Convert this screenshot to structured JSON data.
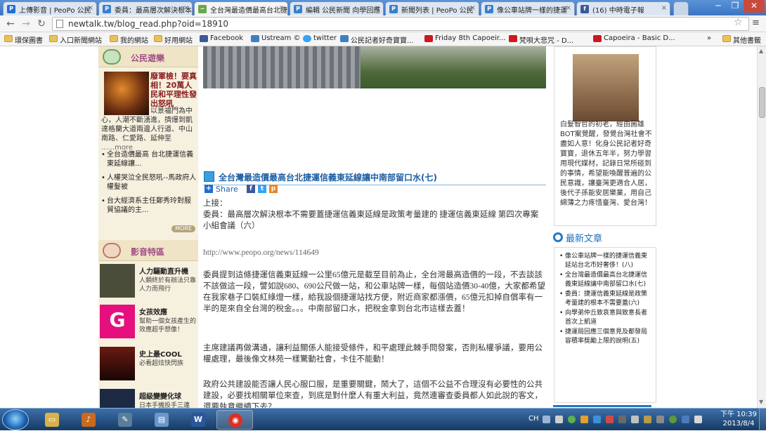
{
  "browser": {
    "tabs": [
      {
        "title": "上傳影音 | PeoPo 公民",
        "favicon_text": "P",
        "favicon_color": "#1f6fd1"
      },
      {
        "title": "委員：最高層次解決根本",
        "favicon_text": "P",
        "favicon_color": "#3a7fd0"
      },
      {
        "title": "全台灣最造價最高台北捷",
        "favicon_text": "~",
        "favicon_color": "#6aa64a"
      },
      {
        "title": "編輯 公民新聞 向學回應",
        "favicon_text": "P",
        "favicon_color": "#3a7fd0"
      },
      {
        "title": "新聞列表 | PeoPo 公民",
        "favicon_text": "P",
        "favicon_color": "#3a7fd0"
      },
      {
        "title": "像公車站牌一樣的捷運",
        "favicon_text": "P",
        "favicon_color": "#3a7fd0"
      },
      {
        "title": "(16) 中時電子報",
        "favicon_text": "f",
        "favicon_color": "#3b5998"
      }
    ],
    "active_tab_index": 2,
    "url": "newtalk.tw/blog_read.php?oid=18910",
    "bookmarks": [
      {
        "label": "環保圖書",
        "icon": "folder-icon"
      },
      {
        "label": "入口新聞網站",
        "icon": "folder-icon"
      },
      {
        "label": "我的網站",
        "icon": "folder-icon"
      },
      {
        "label": "好用網站",
        "icon": "folder-icon"
      },
      {
        "label": "Facebook",
        "icon": "facebook-icon"
      },
      {
        "label": "Ustream ©",
        "icon": "ustream-icon"
      },
      {
        "label": "twitter",
        "icon": "twitter-icon"
      },
      {
        "label": "公民記者好奇寶寶...",
        "icon": "ustream-icon"
      },
      {
        "label": "Friday 8th Capoeir...",
        "icon": "youtube-icon"
      },
      {
        "label": "梵唄大悲咒 - D...",
        "icon": "youtube-icon"
      },
      {
        "label": "Capoeira - Basic D...",
        "icon": "youtube-icon"
      }
    ],
    "bookmarks_overflow": "»",
    "other_bookmarks": "其他書籤"
  },
  "sidebar": {
    "citizen_section_title": "公民遊樂",
    "feature": {
      "title": "廢軍檢！要真相！20萬人民和平理性發出怒吼",
      "body": "以景福門為中心，人潮不斷湧進，擠爆到凱達格蘭大道兩邊人行道、中山南路、仁愛路、延伸至",
      "more": "......more"
    },
    "links": [
      "全台造價最高 台北捷運信義東延線讓...",
      "人權哭泣全民怒吼--馬政府人權髮被",
      "台大經濟系主任鄭秀玲對服貿協議的主..."
    ],
    "more_badge": "MORE",
    "video_section_title": "影音特區",
    "videos": [
      {
        "title": "人力驅動直升機",
        "desc": "人類終於有辦法只靠人力而飛行",
        "thumb_color": "#4a4d3a"
      },
      {
        "title": "女孩效應",
        "desc": "幫助一個女孩產生的效應超乎想像！",
        "thumb_color": "#e5107e",
        "thumb_glyph": "G"
      },
      {
        "title": "史上最COOL",
        "desc": "必看超炫快閃族",
        "thumb_color": "#3a0d0a"
      },
      {
        "title": "超級變變化球",
        "desc": "日本手機投手三連",
        "thumb_color": "#1c2a44"
      }
    ]
  },
  "article": {
    "title": "全台灣最造價最高台北捷運信義東延線讓中南部留口水(七)",
    "share_label": "Share",
    "paragraphs": [
      "上接：",
      "委員：最高層次解決根本不需要蓋捷運信義東延線是政策考量建的 捷運信義東延線 第四次專案小組會議（六）",
      "http://www.peopo.org/news/114649",
      "委員提到這條捷運信義東延線一公里65億元是截至目前為止，全台灣最高造價的一段，不去談該不該做這一段，譬如說680、690公尺做一站，和公車站牌一樣，每個站造價30-40億，大家都希望在我家巷子口裝紅綠燈一樣，給我設個捷運站找方便，附近商家都漲價，65億元扣掉自償率有一半的是來自全台灣的稅金。。。中南部留口水，把稅金拿到台北市這樣去蓋！",
      "主席建議再做溝通，讓利益關係人能接受條件，和平處理此棘手問發案，否則私權爭議，要用公權處理，最後像文林苑一樣驚動社會，卡住不能動！",
      "政府公共建設能否讓人民心服口服，是重要關鍵，鬧大了，這個不公益不合理沒有必要性的公共建設，必要找相關單位來查，到底是對什麼人有重大利益，竟然連審查委員都人如此說的客文，還要執意繼續下去？"
    ]
  },
  "right": {
    "profile_text": "白髮智哲的初老，經由圖雄BOT案覺醒，發覺台灣社會不盡如人意！化身公民記者好奇寶寶，退休五年半，努力學習用現代媒材，記錄日常所碰到的事情，希望能喚醒普遍的公民意識，讓臺灣更適合人居，後代子孫能安居樂業，用自己綿薄之力疼惜臺灣、愛台灣！",
    "latest_title": "最新文章",
    "latest": [
      "像公車站牌一樣的捷運信義東延站台北市好奢侈！(八)",
      "全台灣最造價最高台北捷運信義東延線讓中南部留口水(七)",
      "委員：捷運信義東延線是政策考量建的根本不需要蓋(六)",
      "向學弟仲丘致哀意與致意長者首次上凱道",
      "捷運局回應三個意見及都發局容積率獎勵上限的說明(五)"
    ]
  },
  "taskbar": {
    "apps": [
      {
        "name": "file-explorer",
        "glyph": "▭",
        "color": "#d9b24a"
      },
      {
        "name": "media-player",
        "glyph": "♪",
        "color": "#c96a1f"
      },
      {
        "name": "tools",
        "glyph": "✎",
        "color": "#5a7d9a"
      },
      {
        "name": "notepad",
        "glyph": "▤",
        "color": "#6a96c8"
      },
      {
        "name": "word",
        "glyph": "W",
        "color": "#2b579a"
      },
      {
        "name": "chrome",
        "glyph": "◉",
        "color": "#d93025"
      }
    ],
    "language": "CH",
    "time": "下午 10:39",
    "date": "2013/8/4"
  }
}
